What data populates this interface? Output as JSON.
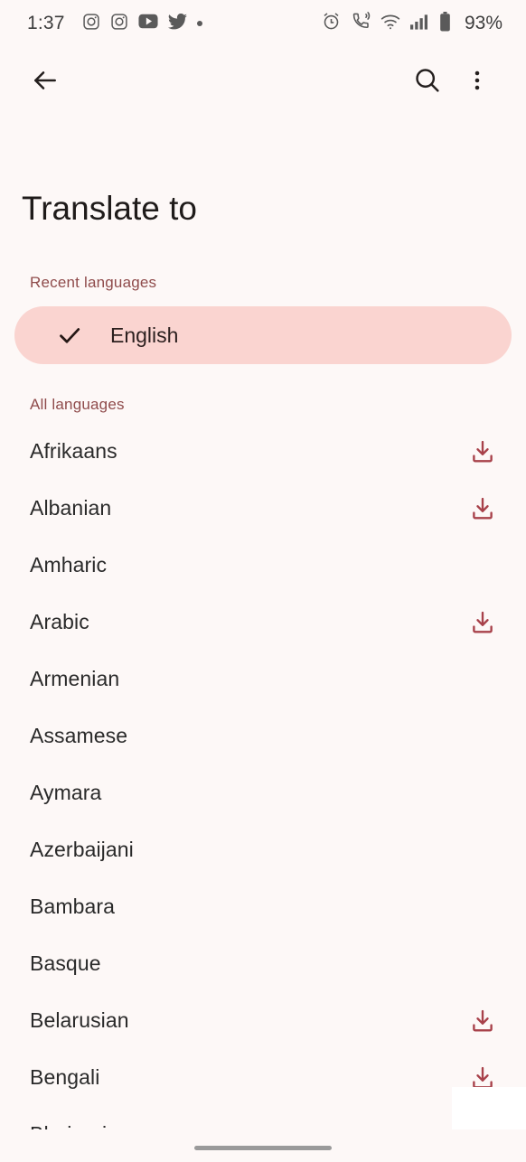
{
  "status_bar": {
    "time": "1:37",
    "battery_percent": "93%",
    "left_icons": [
      "instagram-icon",
      "instagram-icon",
      "youtube-icon",
      "twitter-icon",
      "dot-icon"
    ],
    "right_icons": [
      "alarm-icon",
      "call-vibrate-icon",
      "wifi-icon",
      "cellular-signal-icon",
      "battery-icon"
    ]
  },
  "toolbar": {
    "back_icon": "back-arrow-icon",
    "search_icon": "search-icon",
    "overflow_icon": "more-vert-icon"
  },
  "page": {
    "title": "Translate to"
  },
  "recent_section": {
    "header": "Recent languages",
    "items": [
      {
        "name": "English",
        "selected": true,
        "check_icon": "check-icon"
      }
    ]
  },
  "all_section": {
    "header": "All languages",
    "items": [
      {
        "name": "Afrikaans",
        "downloadable": true
      },
      {
        "name": "Albanian",
        "downloadable": true
      },
      {
        "name": "Amharic",
        "downloadable": false
      },
      {
        "name": "Arabic",
        "downloadable": true
      },
      {
        "name": "Armenian",
        "downloadable": false
      },
      {
        "name": "Assamese",
        "downloadable": false
      },
      {
        "name": "Aymara",
        "downloadable": false
      },
      {
        "name": "Azerbaijani",
        "downloadable": false
      },
      {
        "name": "Bambara",
        "downloadable": false
      },
      {
        "name": "Basque",
        "downloadable": false
      },
      {
        "name": "Belarusian",
        "downloadable": true
      },
      {
        "name": "Bengali",
        "downloadable": true
      },
      {
        "name": "Bhojpuri",
        "downloadable": false
      }
    ]
  },
  "colors": {
    "background": "#FDF8F7",
    "accent_pill": "#FAD4D0",
    "section_header": "#8F4B4B",
    "download_icon": "#A8414A",
    "primary_text": "#2A2A2A"
  },
  "navigation": {
    "gesture_pill": "home-gesture-pill"
  }
}
